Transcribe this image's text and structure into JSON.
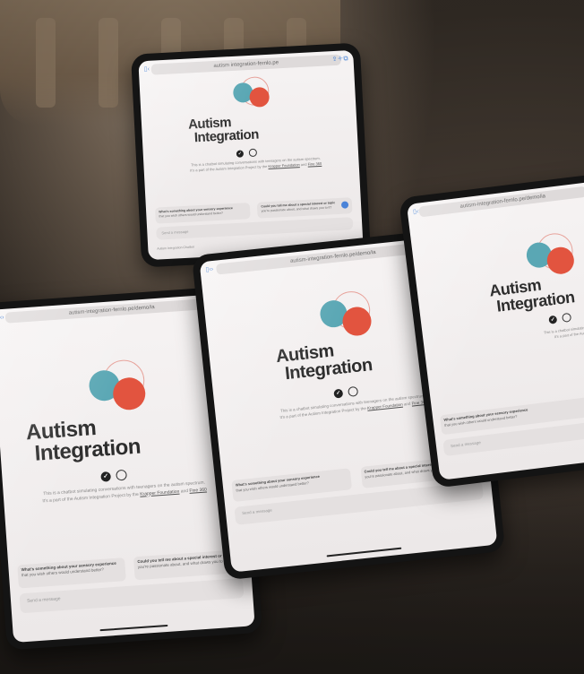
{
  "app": {
    "title_line1": "Autism",
    "title_line2": "Integration",
    "url": "autism-integration-fernlo.pe/demo/ia",
    "url_short": "autism integration-fernlo.pe",
    "description_line1": "This is a chatbot simulating conversations with teenagers on the autism spectrum.",
    "description_line2_prefix": "It's a part of the Autism Integration Project by the",
    "link_foundation": "Krapper Foundation",
    "description_and": "and",
    "link_org": "Fine 360",
    "suggestion_1_title": "What's something about your sensory experience",
    "suggestion_1_sub": "that you wish others would understand better?",
    "suggestion_2_title": "Could you tell me about a special interest or topic",
    "suggestion_2_sub": "you're passionate about, and what draws you to it?",
    "message_placeholder": "Send a message",
    "footer_note": "Autism Integration Chatbot"
  },
  "icons": {
    "tabs": "sidebar-icon",
    "back": "chevron-left-icon",
    "forward": "chevron-right-icon",
    "share": "share-icon",
    "new_tab": "plus-icon",
    "tabs_overview": "tabs-icon",
    "badge_check": "check-badge-icon",
    "badge_chat": "chat-bubble-icon",
    "send": "send-arrow-icon"
  },
  "colors": {
    "teal": "#5aa7b4",
    "coral": "#e2543f",
    "title": "#2d2d2d",
    "accent_blue": "#4a83d8"
  }
}
